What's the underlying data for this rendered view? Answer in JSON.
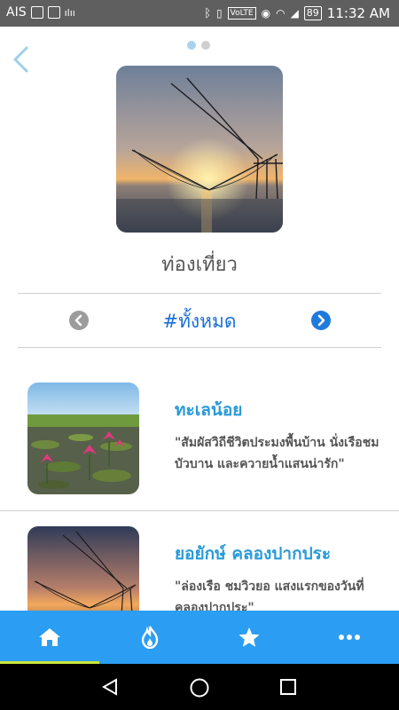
{
  "status_bar": {
    "carrier": "AIS",
    "volte": "VoLTE",
    "battery": "89",
    "time": "11:32 AM"
  },
  "header": {
    "pager_dots": 2,
    "active_dot": 0,
    "page_title": "ท่องเที่ยว"
  },
  "category_nav": {
    "current": "#ทั้งหมด"
  },
  "list": [
    {
      "title": "ทะเลน้อย",
      "description": "\"สัมผัสวิถีชีวิตประมงพื้นบ้าน นั่งเรือชมบัวบาน และควายน้ำแสนน่ารัก\""
    },
    {
      "title": "ยอยักษ์ คลองปากประ",
      "description": "\"ล่องเรือ ชมวิวยอ แสงแรกของวันที่คลองปากประ\""
    }
  ],
  "tabs": [
    {
      "icon": "home-icon",
      "active": true
    },
    {
      "icon": "flame-icon",
      "active": false
    },
    {
      "icon": "star-icon",
      "active": false
    },
    {
      "icon": "more-icon",
      "active": false
    }
  ],
  "colors": {
    "accent": "#2b9df3",
    "title_blue": "#2a9ad8",
    "category_blue": "#1a6fd6",
    "tab_indicator": "#cde63a"
  }
}
